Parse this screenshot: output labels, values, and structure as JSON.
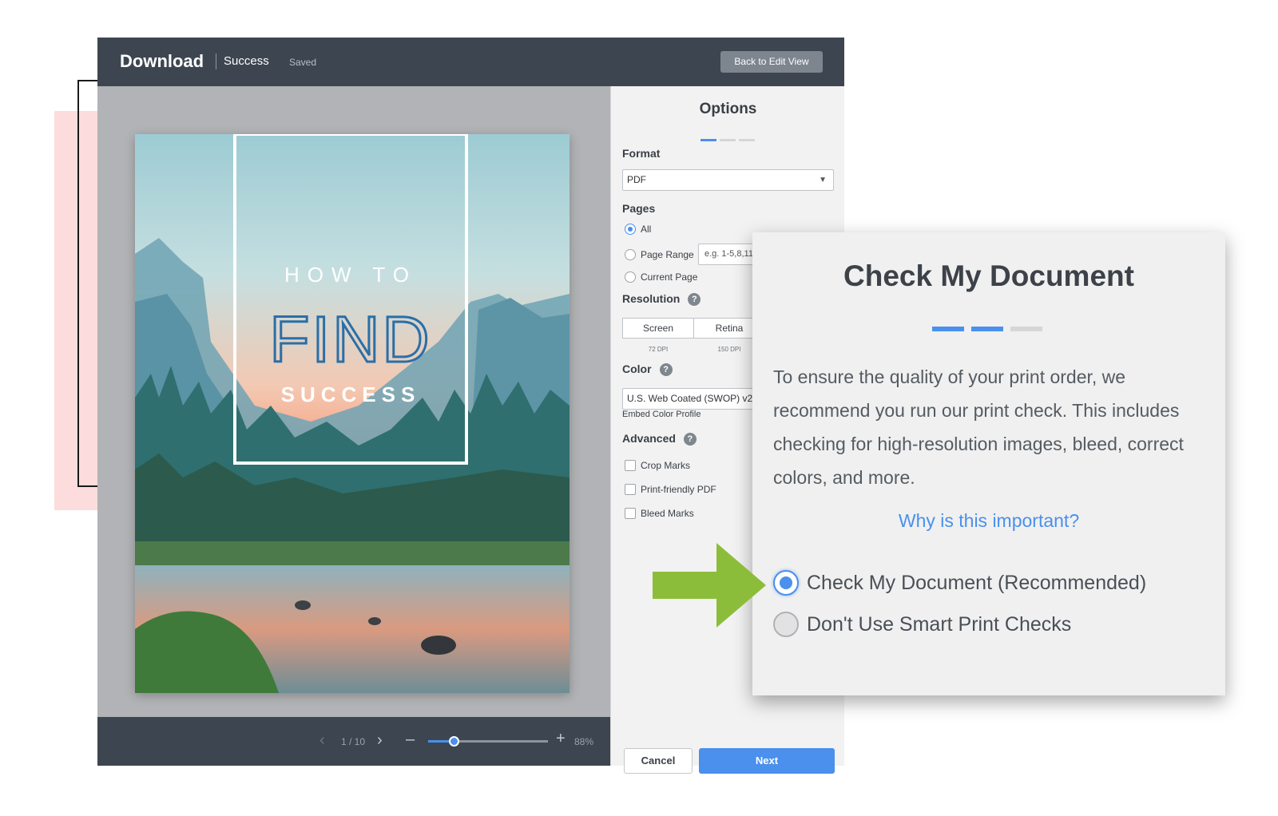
{
  "topbar": {
    "title": "Download",
    "document_name": "Success",
    "save_status": "Saved",
    "back_button": "Back to Edit View"
  },
  "cover": {
    "line1": "HOW TO",
    "line2": "FIND",
    "line3": "SUCCESS"
  },
  "pager": {
    "page_indicator": "1 / 10",
    "zoom_label": "88%",
    "zoom_level": 0.21
  },
  "options": {
    "heading": "Options",
    "format": {
      "label": "Format",
      "value": "PDF"
    },
    "pages": {
      "label": "Pages",
      "all": "All",
      "range": "Page Range",
      "range_placeholder": "e.g. 1-5,8,11",
      "current": "Current Page",
      "selected": "All"
    },
    "resolution": {
      "label": "Resolution",
      "screen": "Screen",
      "screen_dpi": "72 DPI",
      "retina": "Retina",
      "retina_dpi": "150 DPI"
    },
    "color": {
      "label": "Color",
      "profile": "U.S. Web Coated (SWOP) v2",
      "embed": "Embed Color Profile"
    },
    "advanced": {
      "label": "Advanced",
      "crop": "Crop Marks",
      "print_friendly": "Print-friendly PDF",
      "bleed": "Bleed Marks"
    },
    "cancel": "Cancel",
    "next": "Next",
    "help_glyph": "?",
    "accent": "#4a90ec"
  },
  "popup": {
    "title": "Check My Document",
    "description": "To ensure the quality of your print order, we recommend you run our print check. This includes checking for high-resolution images, bleed, correct colors, and more.",
    "link": "Why is this important?",
    "option_recommended": "Check My Document (Recommended)",
    "option_skip": "Don't Use Smart Print Checks",
    "selected": "Check My Document (Recommended)"
  },
  "colors": {
    "topbar": "#3d4650",
    "accent": "#4a90ec",
    "arrow": "#8cbd3a",
    "cover_title": "#2a6fa8"
  }
}
